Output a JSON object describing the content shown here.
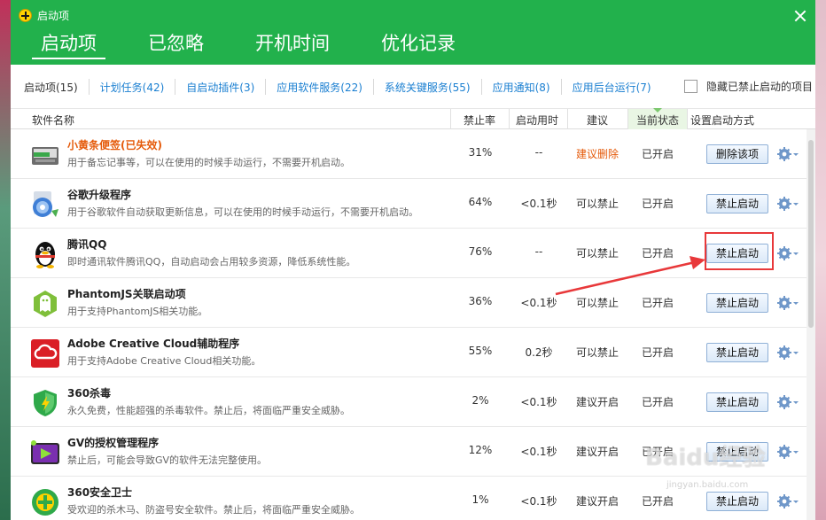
{
  "window": {
    "title": "启动项"
  },
  "main_tabs": [
    {
      "label": "启动项",
      "active": true
    },
    {
      "label": "已忽略",
      "active": false
    },
    {
      "label": "开机时间",
      "active": false
    },
    {
      "label": "优化记录",
      "active": false
    }
  ],
  "subtabs": [
    {
      "label": "启动项(15)",
      "active": true
    },
    {
      "label": "计划任务(42)",
      "active": false
    },
    {
      "label": "自启动插件(3)",
      "active": false
    },
    {
      "label": "应用软件服务(22)",
      "active": false
    },
    {
      "label": "系统关键服务(55)",
      "active": false
    },
    {
      "label": "应用通知(8)",
      "active": false
    },
    {
      "label": "应用后台运行(7)",
      "active": false
    }
  ],
  "hide_disabled": {
    "label": "隐藏已禁止启动的项目",
    "checked": false
  },
  "columns": {
    "name": "软件名称",
    "rate": "禁止率",
    "time": "启动用时",
    "advice": "建议",
    "status": "当前状态",
    "action": "设置启动方式"
  },
  "rows": [
    {
      "icon": "sticky-note-icon",
      "name": "小黄条便签(已失效)",
      "name_warn": true,
      "desc": "用于备忘记事等，可以在使用的时候手动运行，不需要开机启动。",
      "rate": "31%",
      "time": "--",
      "advice": "建议删除",
      "advice_warn": true,
      "status": "已开启",
      "button": "删除该项"
    },
    {
      "icon": "google-updater-icon",
      "name": "谷歌升级程序",
      "name_warn": false,
      "desc": "用于谷歌软件自动获取更新信息，可以在使用的时候手动运行，不需要开机启动。",
      "rate": "64%",
      "time": "<0.1秒",
      "advice": "可以禁止",
      "advice_warn": false,
      "status": "已开启",
      "button": "禁止启动"
    },
    {
      "icon": "qq-penguin-icon",
      "name": "腾讯QQ",
      "name_warn": false,
      "desc": "即时通讯软件腾讯QQ，自动启动会占用较多资源，降低系统性能。",
      "rate": "76%",
      "time": "--",
      "advice": "可以禁止",
      "advice_warn": false,
      "status": "已开启",
      "button": "禁止启动"
    },
    {
      "icon": "phantomjs-icon",
      "name": "PhantomJS关联启动项",
      "name_warn": false,
      "desc": "用于支持PhantomJS相关功能。",
      "rate": "36%",
      "time": "<0.1秒",
      "advice": "可以禁止",
      "advice_warn": false,
      "status": "已开启",
      "button": "禁止启动"
    },
    {
      "icon": "adobe-cc-icon",
      "name": "Adobe Creative Cloud辅助程序",
      "name_warn": false,
      "desc": "用于支持Adobe Creative Cloud相关功能。",
      "rate": "55%",
      "time": "0.2秒",
      "advice": "可以禁止",
      "advice_warn": false,
      "status": "已开启",
      "button": "禁止启动"
    },
    {
      "icon": "360-antivirus-shield-icon",
      "name": "360杀毒",
      "name_warn": false,
      "desc": "永久免费，性能超强的杀毒软件。禁止后，将面临严重安全威胁。",
      "rate": "2%",
      "time": "<0.1秒",
      "advice": "建议开启",
      "advice_warn": false,
      "status": "已开启",
      "button": "禁止启动"
    },
    {
      "icon": "gv-license-icon",
      "name": "GV的授权管理程序",
      "name_warn": false,
      "desc": "禁止后，可能会导致GV的软件无法完整使用。",
      "rate": "12%",
      "time": "<0.1秒",
      "advice": "建议开启",
      "advice_warn": false,
      "status": "已开启",
      "button": "禁止启动"
    },
    {
      "icon": "360-safeguard-icon",
      "name": "360安全卫士",
      "name_warn": false,
      "desc": "受欢迎的杀木马、防盗号安全软件。禁止后，将面临严重安全威胁。",
      "rate": "1%",
      "time": "<0.1秒",
      "advice": "建议开启",
      "advice_warn": false,
      "status": "已开启",
      "button": "禁止启动"
    }
  ],
  "watermark": {
    "main": "Baidu经验",
    "sub": "jingyan.baidu.com"
  },
  "colors": {
    "green": "#22b14c",
    "link": "#1a7fd1",
    "warn": "#e55a0a",
    "annotation": "#e8383a"
  }
}
